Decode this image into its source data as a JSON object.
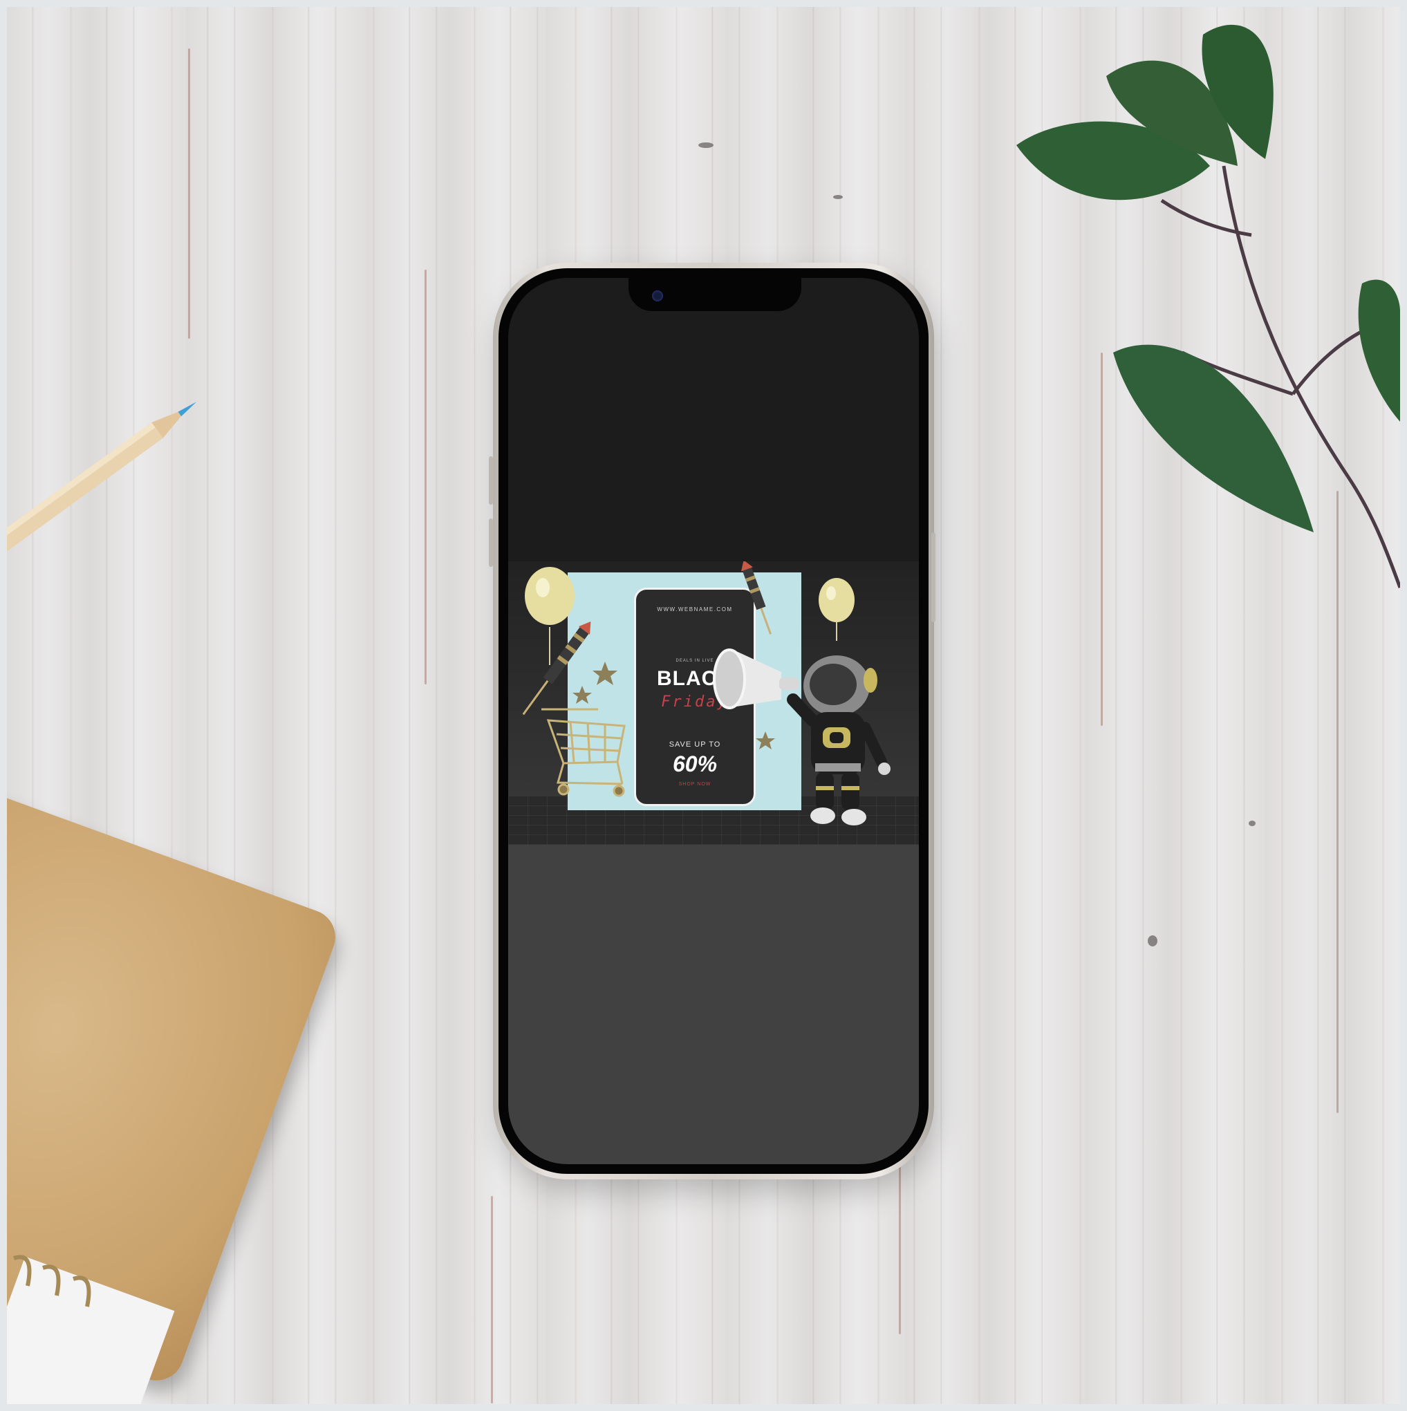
{
  "scene": {
    "description_free": true,
    "background_color": "#e3e2e1"
  },
  "phone": {
    "frame_color": "#d9d3cd",
    "screen_top_color": "#1c1c1c",
    "screen_bottom_color": "#414141"
  },
  "promo": {
    "url": "WWW.WEBNAME.COM",
    "small_caption": "DEALS IN LIVE",
    "headline": "BLACK",
    "subheadline": "Friday",
    "save_label": "SAVE UP TO",
    "discount": "60%",
    "cta": "SHOP NOW",
    "accent_color": "#c9414c",
    "backdrop_color": "#bfe3e6",
    "icons": [
      "balloon-icon",
      "rocket-icon",
      "star-icon",
      "shopping-cart-icon",
      "megaphone-icon",
      "astronaut-icon"
    ]
  },
  "props": {
    "icons": [
      "pencil-icon",
      "notebook-icon",
      "leaf-icon"
    ]
  }
}
